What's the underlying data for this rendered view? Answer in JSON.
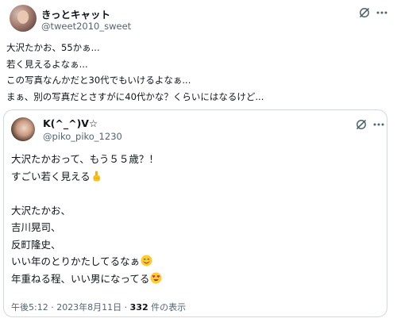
{
  "post": {
    "author_name": "きっとキャット",
    "author_handle": "@tweet2010_sweet",
    "text_lines": [
      "大沢たかお、55かぁ...",
      "若く見えるよなぁ...",
      "この写真なんかだと30代でもいけるよなぁ...",
      "まぁ、別の写真だとさすがに40代かな？くらいにはなるけど..."
    ]
  },
  "quoted": {
    "author_name": "K(^_^)V☆",
    "author_handle": "@piko_piko_1230",
    "lines": [
      "大沢たかおって、もう５５歳？！",
      "すごい若く見える",
      "",
      "大沢たかお、",
      "吉川晃司、",
      "反町隆史、",
      "いい年のとりかたしてるなぁ",
      "年重ねる程、いい男になってる"
    ],
    "timestamp": "午後5:12 · 2023年8月11日 · ",
    "views_count": "332",
    "views_label": " 件の表示"
  },
  "icons": {
    "grok": "grok-icon",
    "more": "more-icon",
    "finger_emoji": "pointing-up-emoji",
    "smile_emoji": "smiling-face-emoji",
    "heart_eyes_emoji": "heart-eyes-emoji"
  }
}
